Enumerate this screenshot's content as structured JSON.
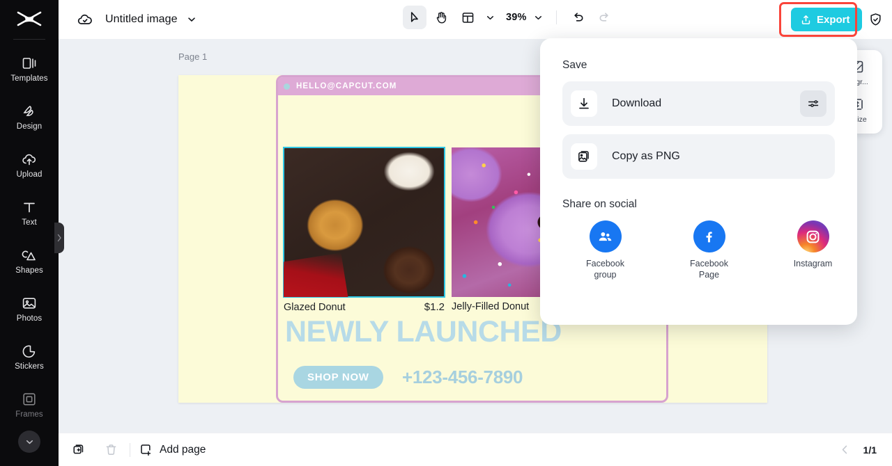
{
  "sidebar": {
    "logo_icon": "capcut-logo-icon",
    "items": [
      {
        "label": "Templates",
        "icon": "templates-icon",
        "dim": false
      },
      {
        "label": "Design",
        "icon": "design-icon",
        "dim": false
      },
      {
        "label": "Upload",
        "icon": "upload-cloud-icon",
        "dim": false
      },
      {
        "label": "Text",
        "icon": "text-icon",
        "dim": false
      },
      {
        "label": "Shapes",
        "icon": "shapes-icon",
        "dim": false
      },
      {
        "label": "Photos",
        "icon": "photos-icon",
        "dim": false
      },
      {
        "label": "Stickers",
        "icon": "stickers-icon",
        "dim": false
      },
      {
        "label": "Frames",
        "icon": "frames-icon",
        "dim": true
      }
    ],
    "more_icon": "chevron-down-icon",
    "handle_icon": "chevron-right-icon"
  },
  "topbar": {
    "cloud_icon": "cloud-saved-icon",
    "doc_title": "Untitled image",
    "title_caret_icon": "chevron-down-icon",
    "tools": [
      {
        "name": "select-tool",
        "icon": "cursor-arrow-icon",
        "active": true
      },
      {
        "name": "hand-tool",
        "icon": "hand-icon",
        "active": false
      },
      {
        "name": "layout-tool",
        "icon": "layout-grid-icon",
        "active": false
      }
    ],
    "layout_caret_icon": "chevron-down-icon",
    "zoom_level": "39%",
    "zoom_caret_icon": "chevron-down-icon",
    "undo_icon": "undo-icon",
    "redo_icon": "redo-icon",
    "export_label": "Export",
    "export_icon": "export-upload-icon",
    "export_color": "#1ECBE1",
    "highlight_color": "#F9443A",
    "shield_icon": "shield-check-icon"
  },
  "workarea": {
    "page_label": "Page 1",
    "right_panel": [
      {
        "label": "...kgr...",
        "icon": "remove-background-icon"
      },
      {
        "label": "...size",
        "icon": "resize-icon"
      }
    ]
  },
  "poster": {
    "header_email": "HELLO@CAPCUT.COM",
    "frame_color": "#D7A3CF",
    "header_color": "#DEAAD6",
    "background_color": "#FCFBD8",
    "selection_color": "#2EC8E6",
    "products": [
      {
        "name": "Glazed Donut",
        "price": "$1.2",
        "photo": "glazed-chocolate-donuts-photo",
        "selected": true
      },
      {
        "name": "Jelly-Filled Donut",
        "price": "",
        "photo": "purple-sprinkle-donuts-photo",
        "selected": false
      }
    ],
    "headline": "NEWLY LAUNCHED",
    "headline_color": "#B7DBE8",
    "cta_label": "SHOP NOW",
    "cta_color": "#A9D6E2",
    "phone": "+123-456-7890"
  },
  "export_menu": {
    "save_heading": "Save",
    "rows": [
      {
        "label": "Download",
        "icon": "download-icon",
        "has_settings": true,
        "settings_icon": "sliders-icon"
      },
      {
        "label": "Copy as PNG",
        "icon": "copy-image-icon",
        "has_settings": false,
        "settings_icon": ""
      }
    ],
    "social_heading": "Share on social",
    "socials": [
      {
        "label": "Facebook\ngroup",
        "label_line1": "Facebook",
        "label_line2": "group",
        "icon": "facebook-group-icon",
        "color": "#1877F2"
      },
      {
        "label": "Facebook\nPage",
        "label_line1": "Facebook",
        "label_line2": "Page",
        "icon": "facebook-icon",
        "color": "#1877F2"
      },
      {
        "label": "Instagram",
        "label_line1": "Instagram",
        "label_line2": "",
        "icon": "instagram-icon",
        "color": "#E1306C"
      }
    ]
  },
  "bottombar": {
    "duplicate_icon": "duplicate-page-icon",
    "delete_icon": "trash-icon",
    "add_page_label": "Add page",
    "add_page_icon": "add-page-icon",
    "prev_icon": "chevron-left-icon",
    "page_count": "1/1"
  }
}
